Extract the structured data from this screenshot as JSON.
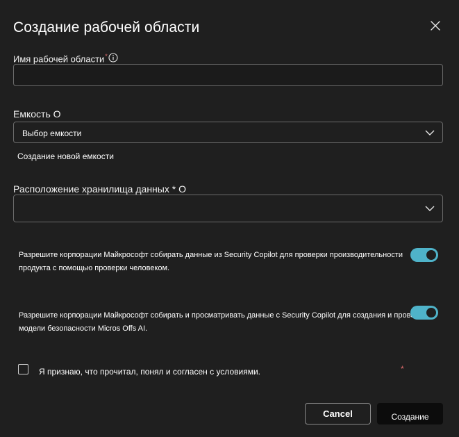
{
  "dialog": {
    "title": "Создание рабочей области",
    "close_icon": "close-icon"
  },
  "workspace_name": {
    "label": "Имя рабочей области",
    "required_mark": "*",
    "info_icon": "info-icon",
    "value": ""
  },
  "capacity": {
    "label": "Емкость О",
    "selected": "Выбор емкости",
    "chevron_icon": "chevron-down-icon",
    "create_link": "Создание новой емкости"
  },
  "storage_location": {
    "label": "Расположение хранилища данных * О",
    "selected": "",
    "chevron_icon": "chevron-down-icon"
  },
  "consents": [
    {
      "text": "Разрешите корпорации Майкрософт собирать данные из Security Copilot для проверки производительности продукта с помощью проверки человеком.",
      "enabled": true
    },
    {
      "text": "Разрешите корпорации Майкрософт собирать и просматривать данные с Security Copilot для создания и проверки модели безопасности Micros Offs AI.",
      "enabled": true
    }
  ],
  "terms": {
    "label": "Я признаю, что прочитал, понял и согласен с условиями.",
    "checked": false,
    "required_mark": "*"
  },
  "actions": {
    "cancel": "Cancel",
    "create": "Создание"
  },
  "colors": {
    "background": "#1f1f1f",
    "toggle_on": "#4fb3c9",
    "required": "#e26d6d"
  }
}
